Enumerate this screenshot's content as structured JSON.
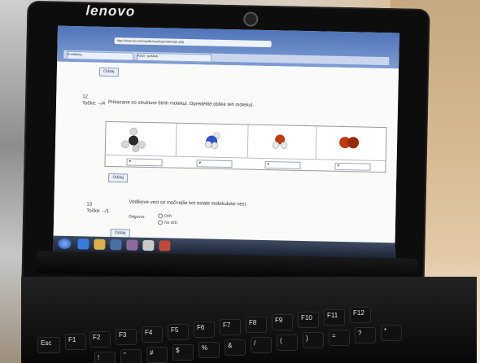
{
  "laptop": {
    "brand": "lenovo"
  },
  "browser": {
    "url": "http://www.sio.si/moodle/mod/quiz/attempt.php",
    "tabs": [
      "E-učilnica",
      "Kvizi - poskus"
    ]
  },
  "quiz": {
    "top_button": "Oddaj",
    "q12": {
      "number": "12",
      "points": "Točke: --/4",
      "text": "Prikazane so strukture štirih molekul. Opredelite oblike teh molekul.",
      "molecules": [
        {
          "name": "tetrahedral-molecule",
          "colors": [
            "#2a2a2a",
            "#d8d8d8"
          ]
        },
        {
          "name": "ammonia-molecule",
          "colors": [
            "#2d55c8",
            "#e8e8e8"
          ]
        },
        {
          "name": "water-molecule",
          "colors": [
            "#c03a12",
            "#e8e8e8"
          ]
        },
        {
          "name": "diatomic-molecule",
          "colors": [
            "#c03a12",
            "#9a2a0c"
          ]
        }
      ],
      "button": "Oddaj"
    },
    "q13": {
      "number": "13",
      "points": "Točke: --/1",
      "text": "Vodikove vezi so močnejše kot ostale molekulske vezi.",
      "answer_label": "Odgovor:",
      "options": [
        "Drži",
        "Ne drži"
      ],
      "button": "Oddaj"
    }
  },
  "taskbar": {
    "icons": [
      "start-orb",
      "ie-icon",
      "explorer-icon",
      "media-icon",
      "app-icon",
      "app-icon-2",
      "app-icon-3"
    ]
  },
  "keyboard": {
    "keys": [
      "Esc",
      "F1",
      "F2",
      "F3",
      "F4",
      "F5",
      "F6",
      "F7",
      "F8",
      "F9",
      "F10",
      "F11",
      "F12",
      "!",
      "\"",
      "#",
      "$",
      "%",
      "&",
      "/",
      "(",
      ")",
      "=",
      "?",
      "*"
    ]
  },
  "colors": {
    "bezel": "#0d0d0d",
    "browser_chrome": "#4f74b8",
    "taskbar": "#1b2233",
    "button_border": "#8a9bb8"
  }
}
